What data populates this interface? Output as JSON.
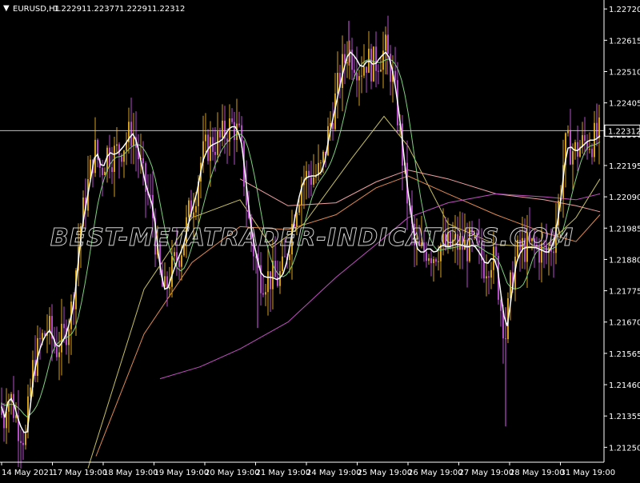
{
  "symbol_label": "EURUSD,H1",
  "ohlc": [
    "1.22291",
    "1.22377",
    "1.22291",
    "1.22312"
  ],
  "current_price": "1.22312",
  "watermark": "BEST-METATRADER-INDICATORS.COM",
  "colors": {
    "background": "#000000",
    "bull_candle": "#d4a017",
    "bear_candle": "#b44cc8",
    "fast_ma": "#ffffff",
    "ma_2": "#7fd07f",
    "ma_3": "#c8c060",
    "ma_4": "#e08a50",
    "ma_5": "#f0a0a0",
    "ma_6": "#c050c0",
    "axis_text": "#ffffff",
    "price_line": "#c0c0c0"
  },
  "chart_data": {
    "type": "candlestick",
    "title": "EURUSD,H1",
    "ylim": [
      1.212,
      1.2275
    ],
    "y_ticks": [
      "1.22720",
      "1.22615",
      "1.22510",
      "1.22405",
      "1.22300",
      "1.22195",
      "1.22090",
      "1.21985",
      "1.21880",
      "1.21775",
      "1.21670",
      "1.21565",
      "1.21460",
      "1.21355",
      "1.21250"
    ],
    "x_ticks": [
      "14 May 2021",
      "17 May 19:00",
      "18 May 19:00",
      "19 May 19:00",
      "20 May 19:00",
      "21 May 19:00",
      "24 May 19:00",
      "25 May 19:00",
      "26 May 19:00",
      "27 May 19:00",
      "28 May 19:00",
      "31 May 19:00"
    ],
    "close_path": [
      [
        0,
        1.214
      ],
      [
        4,
        1.2132
      ],
      [
        8,
        1.2142
      ],
      [
        14,
        1.2141
      ],
      [
        22,
        1.2133
      ],
      [
        32,
        1.2128
      ],
      [
        40,
        1.215
      ],
      [
        50,
        1.216
      ],
      [
        60,
        1.2165
      ],
      [
        70,
        1.2158
      ],
      [
        80,
        1.2162
      ],
      [
        90,
        1.2172
      ],
      [
        100,
        1.2198
      ],
      [
        110,
        1.2213
      ],
      [
        118,
        1.2225
      ],
      [
        126,
        1.2218
      ],
      [
        134,
        1.2224
      ],
      [
        142,
        1.2223
      ],
      [
        150,
        1.2225
      ],
      [
        158,
        1.2228
      ],
      [
        165,
        1.2231
      ],
      [
        172,
        1.2224
      ],
      [
        180,
        1.2213
      ],
      [
        190,
        1.2205
      ],
      [
        198,
        1.2185
      ],
      [
        205,
        1.2176
      ],
      [
        212,
        1.2182
      ],
      [
        220,
        1.2188
      ],
      [
        228,
        1.2193
      ],
      [
        236,
        1.2203
      ],
      [
        244,
        1.221
      ],
      [
        252,
        1.2222
      ],
      [
        260,
        1.2226
      ],
      [
        268,
        1.2227
      ],
      [
        276,
        1.2228
      ],
      [
        284,
        1.2232
      ],
      [
        292,
        1.2233
      ],
      [
        300,
        1.2228
      ],
      [
        306,
        1.2213
      ],
      [
        312,
        1.2198
      ],
      [
        318,
        1.219
      ],
      [
        324,
        1.2183
      ],
      [
        330,
        1.2182
      ],
      [
        338,
        1.2182
      ],
      [
        346,
        1.2181
      ],
      [
        354,
        1.2184
      ],
      [
        362,
        1.2195
      ],
      [
        370,
        1.2207
      ],
      [
        378,
        1.2215
      ],
      [
        386,
        1.2216
      ],
      [
        394,
        1.2216
      ],
      [
        402,
        1.2218
      ],
      [
        410,
        1.223
      ],
      [
        418,
        1.224
      ],
      [
        426,
        1.225
      ],
      [
        434,
        1.2258
      ],
      [
        442,
        1.2256
      ],
      [
        450,
        1.2252
      ],
      [
        458,
        1.2255
      ],
      [
        466,
        1.2253
      ],
      [
        474,
        1.2256
      ],
      [
        482,
        1.2258
      ],
      [
        490,
        1.225
      ],
      [
        498,
        1.2235
      ],
      [
        506,
        1.2215
      ],
      [
        512,
        1.2203
      ],
      [
        518,
        1.2192
      ],
      [
        526,
        1.219
      ],
      [
        534,
        1.2192
      ],
      [
        542,
        1.219
      ],
      [
        550,
        1.2193
      ],
      [
        558,
        1.2192
      ],
      [
        566,
        1.2193
      ],
      [
        574,
        1.2193
      ],
      [
        582,
        1.2192
      ],
      [
        590,
        1.2193
      ],
      [
        598,
        1.219
      ],
      [
        606,
        1.2186
      ],
      [
        614,
        1.2189
      ],
      [
        620,
        1.2186
      ],
      [
        626,
        1.2172
      ],
      [
        632,
        1.2163
      ],
      [
        638,
        1.2178
      ],
      [
        644,
        1.2188
      ],
      [
        652,
        1.2192
      ],
      [
        660,
        1.2192
      ],
      [
        668,
        1.2192
      ],
      [
        676,
        1.2191
      ],
      [
        684,
        1.219
      ],
      [
        692,
        1.2195
      ],
      [
        700,
        1.221
      ],
      [
        706,
        1.2225
      ],
      [
        712,
        1.2226
      ],
      [
        718,
        1.2224
      ],
      [
        726,
        1.2226
      ],
      [
        734,
        1.2228
      ],
      [
        742,
        1.2228
      ],
      [
        750,
        1.223
      ]
    ],
    "moving_averages": [
      {
        "color_key": "ma_3",
        "points": [
          [
            110,
            1.2118
          ],
          [
            180,
            1.2178
          ],
          [
            240,
            1.2202
          ],
          [
            300,
            1.2208
          ],
          [
            340,
            1.2192
          ],
          [
            380,
            1.22
          ],
          [
            440,
            1.2222
          ],
          [
            480,
            1.2236
          ],
          [
            510,
            1.2226
          ],
          [
            560,
            1.22
          ],
          [
            620,
            1.2193
          ],
          [
            680,
            1.2192
          ],
          [
            720,
            1.2202
          ],
          [
            750,
            1.2215
          ]
        ]
      },
      {
        "color_key": "ma_4",
        "points": [
          [
            120,
            1.2122
          ],
          [
            180,
            1.2163
          ],
          [
            240,
            1.2187
          ],
          [
            300,
            1.2199
          ],
          [
            360,
            1.2198
          ],
          [
            420,
            1.2203
          ],
          [
            470,
            1.2212
          ],
          [
            510,
            1.2216
          ],
          [
            560,
            1.221
          ],
          [
            620,
            1.2203
          ],
          [
            680,
            1.2197
          ],
          [
            720,
            1.2194
          ],
          [
            750,
            1.2203
          ]
        ]
      },
      {
        "color_key": "ma_5",
        "points": [
          [
            300,
            1.2215
          ],
          [
            360,
            1.2206
          ],
          [
            420,
            1.2207
          ],
          [
            470,
            1.2214
          ],
          [
            510,
            1.2218
          ],
          [
            560,
            1.2215
          ],
          [
            620,
            1.221
          ],
          [
            680,
            1.2208
          ],
          [
            720,
            1.2206
          ],
          [
            750,
            1.2204
          ]
        ]
      },
      {
        "color_key": "ma_6",
        "points": [
          [
            200,
            1.2148
          ],
          [
            250,
            1.2152
          ],
          [
            300,
            1.2158
          ],
          [
            360,
            1.2167
          ],
          [
            420,
            1.2182
          ],
          [
            470,
            1.2193
          ],
          [
            510,
            1.2202
          ],
          [
            560,
            1.2207
          ],
          [
            620,
            1.221
          ],
          [
            680,
            1.2209
          ],
          [
            720,
            1.2208
          ],
          [
            750,
            1.221
          ]
        ]
      }
    ]
  }
}
